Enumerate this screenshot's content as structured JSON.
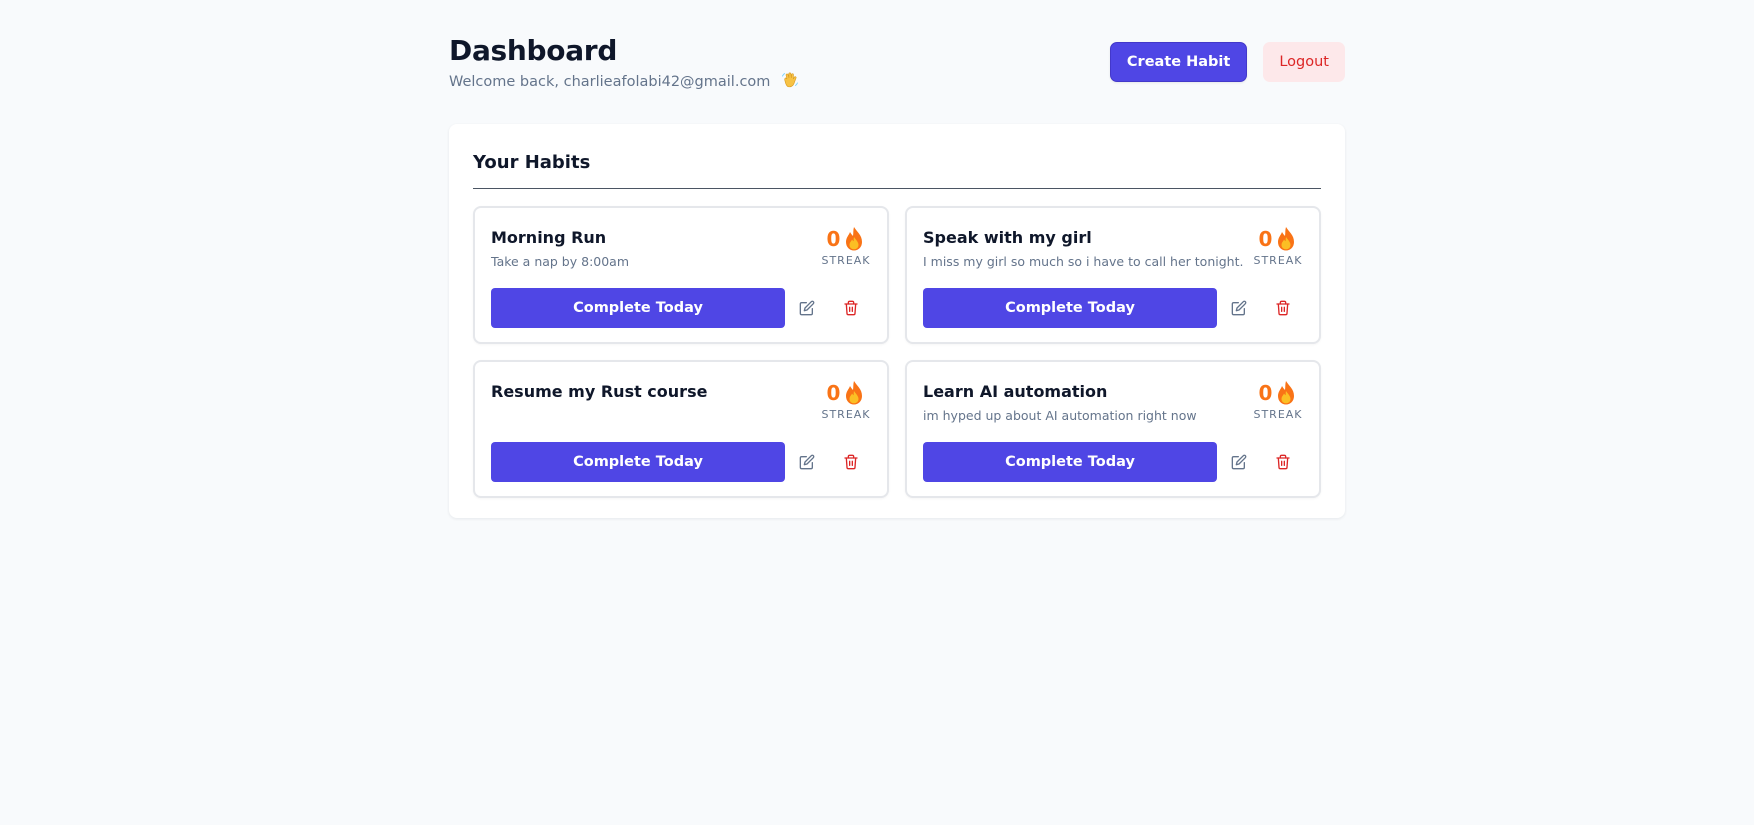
{
  "header": {
    "title": "Dashboard",
    "welcome_text": "Welcome back, charlieafolabi42@gmail.com",
    "create_label": "Create Habit",
    "logout_label": "Logout"
  },
  "panel": {
    "title": "Your Habits"
  },
  "habits": [
    {
      "name": "Morning Run",
      "description": "Take a nap by 8:00am",
      "streak": "0",
      "streak_label": "STREAK",
      "complete_label": "Complete Today"
    },
    {
      "name": "Speak with my girl",
      "description": "I miss my girl so much so i have to call her tonight.",
      "streak": "0",
      "streak_label": "STREAK",
      "complete_label": "Complete Today"
    },
    {
      "name": "Resume my Rust course",
      "description": "",
      "streak": "0",
      "streak_label": "STREAK",
      "complete_label": "Complete Today"
    },
    {
      "name": "Learn AI automation",
      "description": "im hyped up about AI automation right now",
      "streak": "0",
      "streak_label": "STREAK",
      "complete_label": "Complete Today"
    }
  ],
  "icons": {
    "welcome": "waving-hand-icon",
    "streak": "fire-icon",
    "edit": "edit-icon",
    "delete": "trash-icon"
  },
  "colors": {
    "primary": "#4f46e5",
    "danger": "#dc2626",
    "logout_bg": "#fde8ea",
    "streak": "#f97316",
    "background": "#f8fafc"
  }
}
